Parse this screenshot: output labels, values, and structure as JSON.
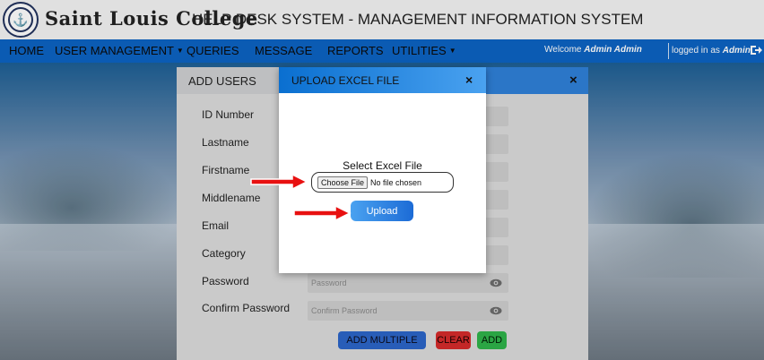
{
  "header": {
    "brand": "Saint Louis College",
    "system_title": "HELP DESK SYSTEM - MANAGEMENT INFORMATION SYSTEM"
  },
  "nav": {
    "home": "HOME",
    "user_management": "USER MANAGEMENT",
    "queries": "QUERIES",
    "message": "MESSAGE",
    "reports": "REPORTS",
    "utilities": "UTILITIES",
    "welcome_prefix": "Welcome",
    "welcome_user": "Admin Admin",
    "logged_prefix": "logged in as",
    "logged_user": "Admin"
  },
  "add_users": {
    "title": "ADD USERS",
    "close": "×",
    "fields": {
      "id_number": "ID Number",
      "lastname": "Lastname",
      "firstname": "Firstname",
      "middlename": "Middlename",
      "email": "Email",
      "category": "Category",
      "password": "Password",
      "confirm_password": "Confirm Password"
    },
    "placeholders": {
      "password": "Password",
      "confirm_password": "Confirm Password"
    },
    "buttons": {
      "add_multiple": "ADD MULTIPLE",
      "clear": "CLEAR",
      "add": "ADD"
    }
  },
  "modal": {
    "title": "UPLOAD EXCEL FILE",
    "close": "×",
    "select_label": "Select Excel File",
    "choose_file": "Choose File",
    "no_file": "No file chosen",
    "upload": "Upload"
  },
  "colors": {
    "navbar": "#0d63c3",
    "modal_header": "#0a6fd0",
    "arrow": "#e81010",
    "clear": "#d52b2b",
    "add": "#2fb34a"
  }
}
